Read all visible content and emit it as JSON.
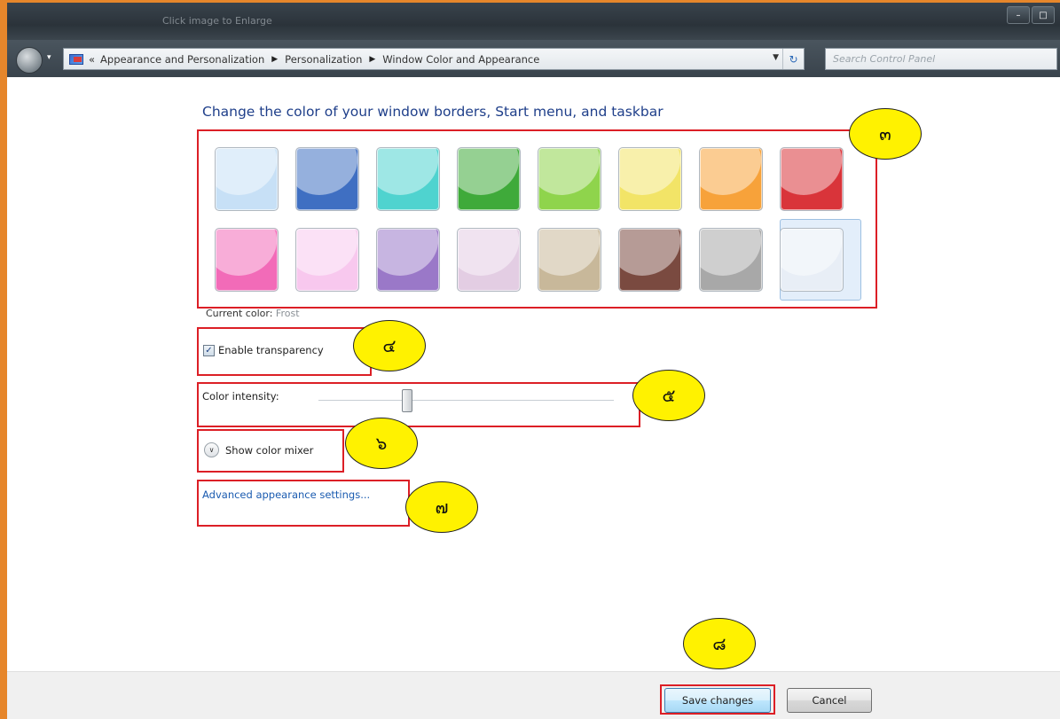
{
  "window": {
    "title": "Click image to Enlarge"
  },
  "address_bar": {
    "overflow_label": "«",
    "breadcrumb": [
      "Appearance and Personalization",
      "Personalization",
      "Window Color and Appearance"
    ],
    "search_placeholder": "Search Control Panel"
  },
  "page": {
    "heading": "Change the color of your window borders, Start menu, and taskbar",
    "swatches_row1": [
      "#c7e0f6",
      "#3f6fc2",
      "#4fd3cf",
      "#3faa3a",
      "#8fd44c",
      "#f2e467",
      "#f7a23a",
      "#d9343a"
    ],
    "swatches_row2": [
      "#f26bb8",
      "#f8c8ee",
      "#9a78c8",
      "#e3cde3",
      "#c8b89a",
      "#7a4a40",
      "#a8a8a8",
      "#e8eef6"
    ],
    "current_color_label": "Current color:",
    "current_color_value": "Frost",
    "transparency_label": "Enable transparency",
    "transparency_checked": true,
    "intensity_label": "Color intensity:",
    "intensity_value": 0.3,
    "mixer_label": "Show color mixer",
    "advanced_link": "Advanced appearance settings...",
    "save_label": "Save changes",
    "cancel_label": "Cancel"
  },
  "annotations": {
    "badge_3": "๓",
    "badge_4": "๔",
    "badge_5": "๕",
    "badge_6": "๖",
    "badge_7": "๗",
    "badge_8": "๘",
    "box_color": "#dc1f26",
    "badge_color": "#fff200"
  }
}
